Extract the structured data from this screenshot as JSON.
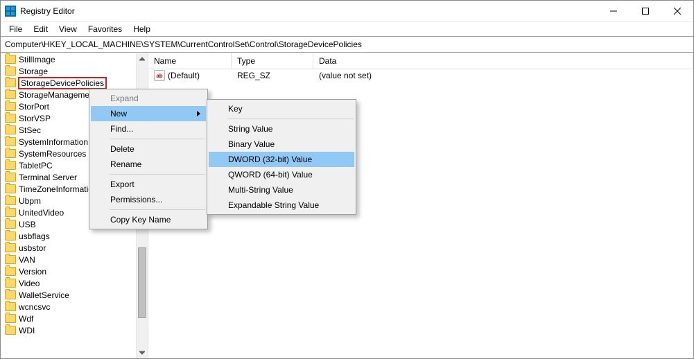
{
  "title": "Registry Editor",
  "menus": {
    "file": "File",
    "edit": "Edit",
    "view": "View",
    "favorites": "Favorites",
    "help": "Help"
  },
  "address": "Computer\\HKEY_LOCAL_MACHINE\\SYSTEM\\CurrentControlSet\\Control\\StorageDevicePolicies",
  "tree": {
    "items": [
      "StillImage",
      "Storage",
      "StorageDevicePolicies",
      "StorageManagement",
      "StorPort",
      "StorVSP",
      "StSec",
      "SystemInformation",
      "SystemResources",
      "TabletPC",
      "Terminal Server",
      "TimeZoneInformation",
      "Ubpm",
      "UnitedVideo",
      "USB",
      "usbflags",
      "usbstor",
      "VAN",
      "Version",
      "Video",
      "WalletService",
      "wcncsvc",
      "Wdf",
      "WDI"
    ],
    "selectedIndex": 2
  },
  "list": {
    "headers": {
      "name": "Name",
      "type": "Type",
      "data": "Data"
    },
    "rows": [
      {
        "icon": "ab",
        "name": "(Default)",
        "type": "REG_SZ",
        "data": "(value not set)"
      }
    ]
  },
  "ctx1": {
    "expand": "Expand",
    "new": "New",
    "find": "Find...",
    "delete": "Delete",
    "rename": "Rename",
    "export": "Export",
    "permissions": "Permissions...",
    "copykey": "Copy Key Name"
  },
  "ctx2": {
    "key": "Key",
    "string": "String Value",
    "binary": "Binary Value",
    "dword": "DWORD (32-bit) Value",
    "qword": "QWORD (64-bit) Value",
    "multi": "Multi-String Value",
    "expand": "Expandable String Value"
  }
}
